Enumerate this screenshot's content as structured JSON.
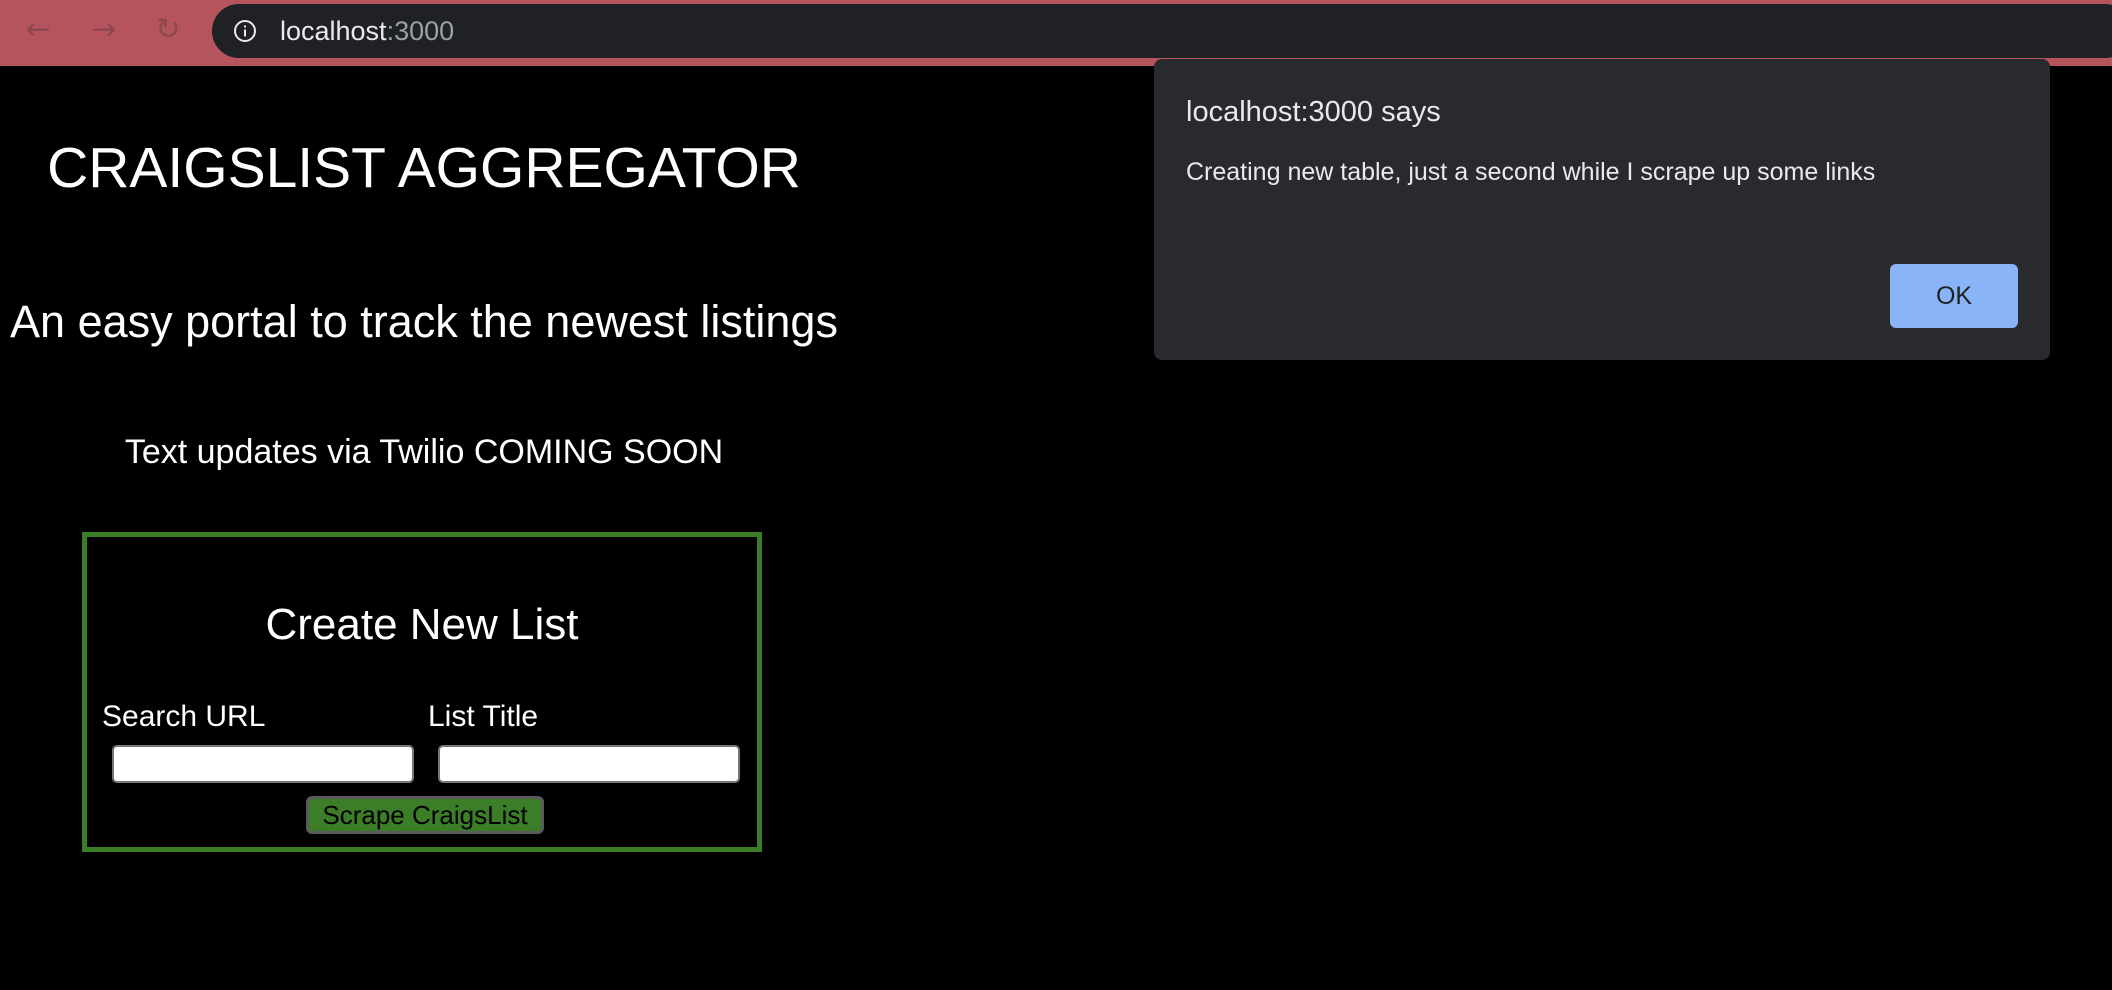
{
  "browser": {
    "nav": {
      "back_icon": "back-arrow-icon",
      "forward_icon": "forward-arrow-icon",
      "reload_icon": "reload-icon"
    },
    "address_bar": {
      "host": "localhost",
      "port": ":3000",
      "info_icon": "info-icon"
    },
    "colors": {
      "tab_strip": "#b5545c",
      "omnibox": "#202124"
    }
  },
  "page": {
    "title": "CRAIGSLIST AGGREGATOR",
    "subtitle": "An easy portal to track the newest listings",
    "notice": "Text updates via Twilio COMING SOON",
    "form": {
      "heading": "Create New List",
      "search_url_label": "Search URL",
      "search_url_value": "",
      "list_title_label": "List Title",
      "list_title_value": "",
      "submit_label": "Scrape CraigsList",
      "border_color": "#3c7d28"
    }
  },
  "alert": {
    "title": "localhost:3000 says",
    "message": "Creating new table, just a second while I scrape up some links",
    "ok_label": "OK",
    "ok_color": "#8ab4f8"
  }
}
